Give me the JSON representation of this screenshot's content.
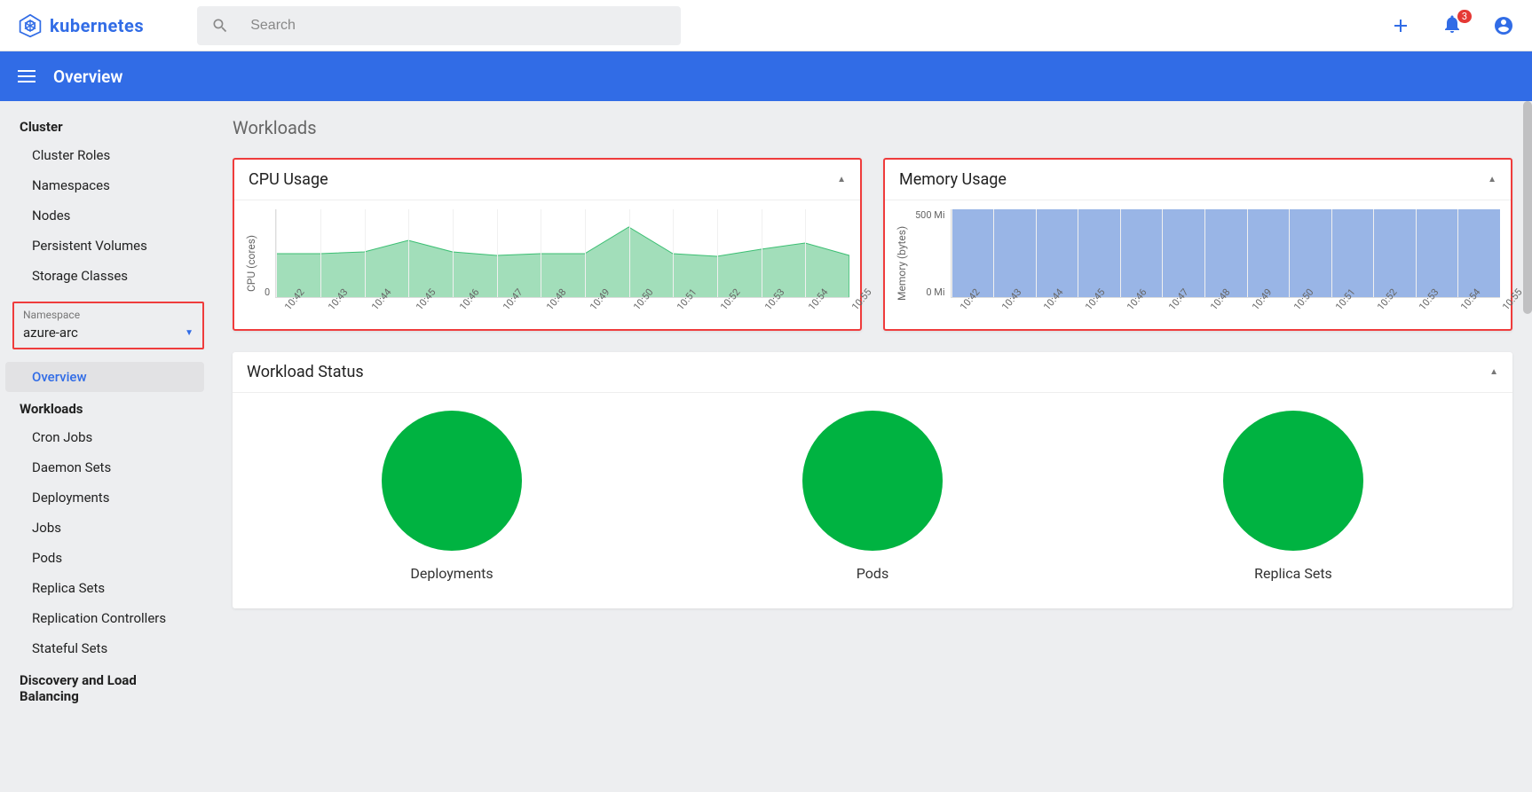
{
  "logo": {
    "text": "kubernetes"
  },
  "search": {
    "placeholder": "Search"
  },
  "notifications": {
    "count": "3"
  },
  "subheader": {
    "title": "Overview"
  },
  "sidebar": {
    "cluster_title": "Cluster",
    "cluster_items": [
      "Cluster Roles",
      "Namespaces",
      "Nodes",
      "Persistent Volumes",
      "Storage Classes"
    ],
    "namespace": {
      "label": "Namespace",
      "value": "azure-arc"
    },
    "overview": "Overview",
    "workloads_title": "Workloads",
    "workloads_items": [
      "Cron Jobs",
      "Daemon Sets",
      "Deployments",
      "Jobs",
      "Pods",
      "Replica Sets",
      "Replication Controllers",
      "Stateful Sets"
    ],
    "discovery_title": "Discovery and Load Balancing"
  },
  "main": {
    "title": "Workloads",
    "cpu_card": {
      "title": "CPU Usage",
      "ylabel": "CPU (cores)",
      "ytick_top": "",
      "ytick_bottom": "0"
    },
    "mem_card": {
      "title": "Memory Usage",
      "ylabel": "Memory (bytes)",
      "ytick_top": "500 Mi",
      "ytick_bottom": "0 Mi"
    },
    "workload_card": {
      "title": "Workload Status"
    },
    "donuts": [
      "Deployments",
      "Pods",
      "Replica Sets"
    ]
  },
  "chart_data": [
    {
      "type": "area",
      "title": "CPU Usage",
      "ylabel": "CPU (cores)",
      "xlabel": "",
      "ylim": [
        0,
        1
      ],
      "categories": [
        "10:42",
        "10:43",
        "10:44",
        "10:45",
        "10:46",
        "10:47",
        "10:48",
        "10:49",
        "10:50",
        "10:51",
        "10:52",
        "10:53",
        "10:54",
        "10:55"
      ],
      "values": [
        0.5,
        0.5,
        0.52,
        0.65,
        0.52,
        0.48,
        0.5,
        0.5,
        0.8,
        0.5,
        0.47,
        0.55,
        0.62,
        0.48
      ]
    },
    {
      "type": "area",
      "title": "Memory Usage",
      "ylabel": "Memory (bytes)",
      "xlabel": "",
      "ylim": [
        0,
        500
      ],
      "categories": [
        "10:42",
        "10:43",
        "10:44",
        "10:45",
        "10:46",
        "10:47",
        "10:48",
        "10:49",
        "10:50",
        "10:51",
        "10:52",
        "10:53",
        "10:54",
        "10:55"
      ],
      "values": [
        500,
        500,
        500,
        500,
        500,
        500,
        500,
        500,
        500,
        500,
        500,
        500,
        500,
        500
      ]
    }
  ]
}
